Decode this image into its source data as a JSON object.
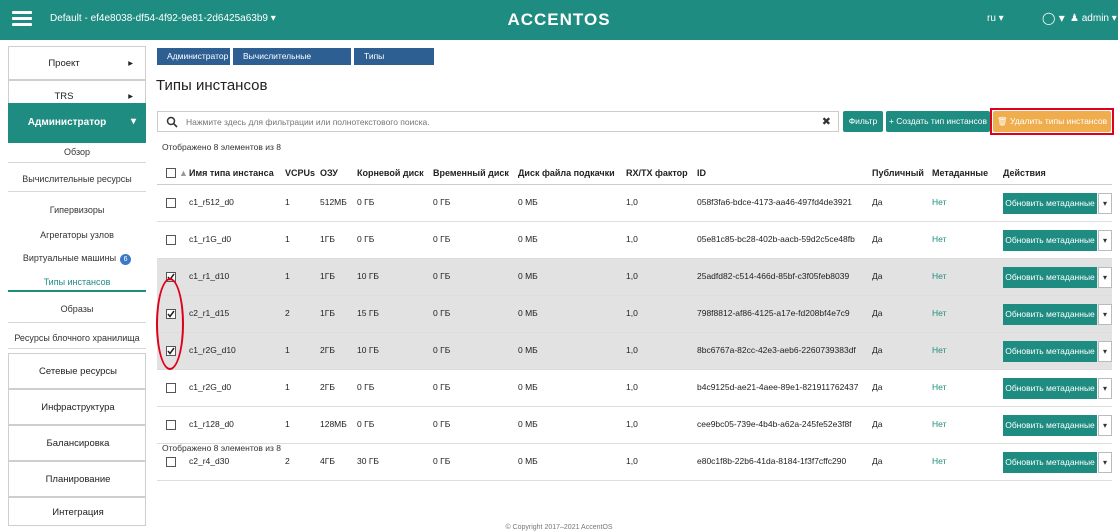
{
  "header": {
    "project": "Default - ef4e8038-df54-4f92-9e81-2d6425a63b9 ▾",
    "logo": "ACCENTOS",
    "lang": "ru ▾",
    "theme": "◯ ▾",
    "user": "admin ▾",
    "brand_color": "#1f8c82"
  },
  "sidebar": {
    "top": [
      {
        "label": "Проект",
        "arrow": "▸"
      },
      {
        "label": "TRS",
        "arrow": "▸"
      }
    ],
    "admin": {
      "label": "Администратор",
      "arrow": "▾"
    },
    "items": [
      {
        "label": "Обзор"
      },
      {
        "label": "Вычислительные ресурсы"
      },
      {
        "label": "Гипервизоры"
      },
      {
        "label": "Агрегаторы узлов"
      },
      {
        "label": "Виртуальные машины",
        "badge": "6"
      },
      {
        "label": "Типы инстансов"
      },
      {
        "label": "Образы"
      },
      {
        "label": "Ресурсы блочного хранилища"
      }
    ],
    "bottom": [
      {
        "label": "Сетевые ресурсы"
      },
      {
        "label": "Инфраструктура"
      },
      {
        "label": "Балансировка"
      },
      {
        "label": "Планирование"
      },
      {
        "label": "Интеграция"
      }
    ]
  },
  "breadcrumb": [
    "Администратор",
    "Вычислительные ресурсы",
    "Типы инстансов"
  ],
  "page_title": "Типы инстансов",
  "search": {
    "placeholder": "Нажмите здесь для фильтрации или полнотекстового поиска.",
    "clear": "✖"
  },
  "buttons": {
    "filter": "Фильтр",
    "create": "+ Создать тип инстансов",
    "delete": "🗑 Удалить типы инстансов"
  },
  "count_text": "Отображено 8 элементов из 8",
  "table": {
    "columns": [
      "Имя типа инстанса",
      "VCPUs",
      "ОЗУ",
      "Корневой диск",
      "Временный диск",
      "Диск файла подкачки",
      "RX/TX фактор",
      "ID",
      "Публичный",
      "Метаданные",
      "Действия"
    ],
    "action_label": "Обновить метаданные",
    "rows": [
      {
        "name": "c1_r512_d0",
        "vcpus": "1",
        "ram": "512МБ",
        "root": "0 ГБ",
        "ephemeral": "0 ГБ",
        "swap": "0 МБ",
        "rxtx": "1,0",
        "id": "058f3fa6-bdce-4173-aa46-497fd4de3921",
        "public": "Да",
        "meta": "Нет",
        "selected": false
      },
      {
        "name": "c1_r1G_d0",
        "vcpus": "1",
        "ram": "1ГБ",
        "root": "0 ГБ",
        "ephemeral": "0 ГБ",
        "swap": "0 МБ",
        "rxtx": "1,0",
        "id": "05e81c85-bc28-402b-aacb-59d2c5ce48fb",
        "public": "Да",
        "meta": "Нет",
        "selected": false
      },
      {
        "name": "c1_r1_d10",
        "vcpus": "1",
        "ram": "1ГБ",
        "root": "10 ГБ",
        "ephemeral": "0 ГБ",
        "swap": "0 МБ",
        "rxtx": "1,0",
        "id": "25adfd82-c514-466d-85bf-c3f05feb8039",
        "public": "Да",
        "meta": "Нет",
        "selected": true
      },
      {
        "name": "c2_r1_d15",
        "vcpus": "2",
        "ram": "1ГБ",
        "root": "15 ГБ",
        "ephemeral": "0 ГБ",
        "swap": "0 МБ",
        "rxtx": "1,0",
        "id": "798f8812-af86-4125-a17e-fd208bf4e7c9",
        "public": "Да",
        "meta": "Нет",
        "selected": true
      },
      {
        "name": "c1_r2G_d10",
        "vcpus": "1",
        "ram": "2ГБ",
        "root": "10 ГБ",
        "ephemeral": "0 ГБ",
        "swap": "0 МБ",
        "rxtx": "1,0",
        "id": "8bc6767a-82cc-42e3-aeb6-2260739383df",
        "public": "Да",
        "meta": "Нет",
        "selected": true
      },
      {
        "name": "c1_r2G_d0",
        "vcpus": "1",
        "ram": "2ГБ",
        "root": "0 ГБ",
        "ephemeral": "0 ГБ",
        "swap": "0 МБ",
        "rxtx": "1,0",
        "id": "b4c9125d-ae21-4aee-89e1-821911762437",
        "public": "Да",
        "meta": "Нет",
        "selected": false
      },
      {
        "name": "c1_r128_d0",
        "vcpus": "1",
        "ram": "128МБ",
        "root": "0 ГБ",
        "ephemeral": "0 ГБ",
        "swap": "0 МБ",
        "rxtx": "1,0",
        "id": "cee9bc05-739e-4b4b-a62a-245fe52e3f8f",
        "public": "Да",
        "meta": "Нет",
        "selected": false
      },
      {
        "name": "c2_r4_d30",
        "vcpus": "2",
        "ram": "4ГБ",
        "root": "30 ГБ",
        "ephemeral": "0 ГБ",
        "swap": "0 МБ",
        "rxtx": "1,0",
        "id": "e80c1f8b-22b6-41da-8184-1f3f7cffc290",
        "public": "Да",
        "meta": "Нет",
        "selected": false
      }
    ]
  },
  "footer": "© Copyright 2017–2021 AccentOS"
}
